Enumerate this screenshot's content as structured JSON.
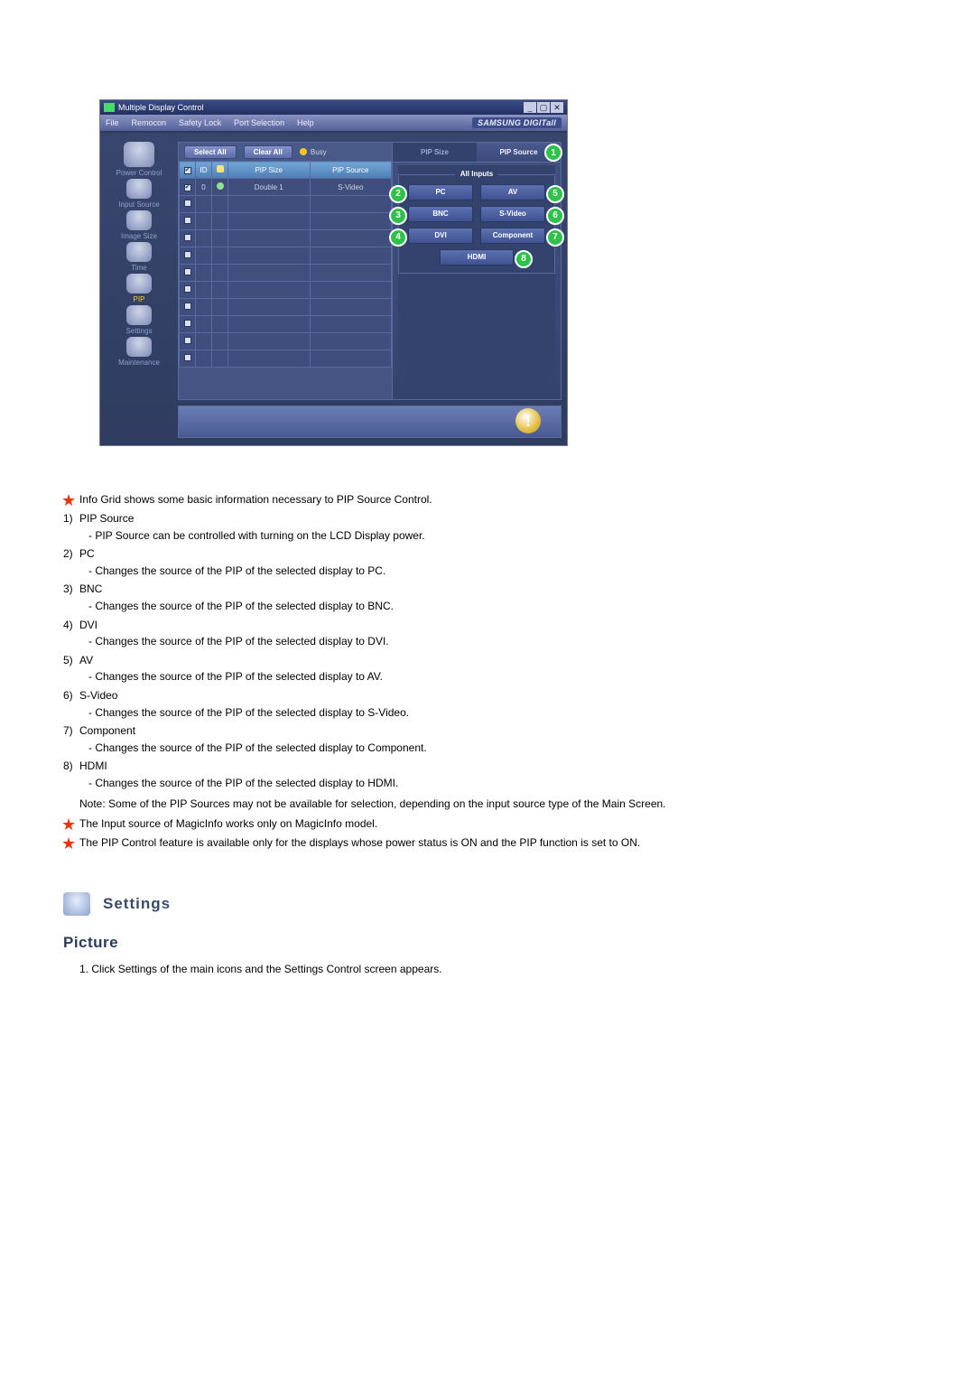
{
  "win": {
    "title": "Multiple Display Control",
    "menus": [
      "File",
      "Remocon",
      "Safety Lock",
      "Port Selection",
      "Help"
    ],
    "brand": "SAMSUNG DIGITall"
  },
  "sidebar": {
    "items": [
      {
        "label": "Power Control"
      },
      {
        "label": "Input Source"
      },
      {
        "label": "Image Size"
      },
      {
        "label": "Time"
      },
      {
        "label": "PIP"
      },
      {
        "label": "Settings"
      },
      {
        "label": "Maintenance"
      }
    ],
    "active_index": 4
  },
  "topbuttons": {
    "select_all": "Select All",
    "clear_all": "Clear All",
    "busy": "Busy"
  },
  "grid": {
    "headers": {
      "chk": "",
      "id": "ID",
      "status": "",
      "pip_size": "PIP Size",
      "pip_source": "PIP Source"
    },
    "rows": [
      {
        "chk": true,
        "id": "0",
        "status": "on",
        "pip_size": "Double 1",
        "pip_source": "S-Video"
      }
    ]
  },
  "right": {
    "tab_inactive": "PIP Size",
    "tab_active": "PIP Source",
    "legend": "All Inputs",
    "buttons": {
      "pc": "PC",
      "bnc": "BNC",
      "dvi": "DVI",
      "av": "AV",
      "svideo": "S-Video",
      "component": "Component",
      "hdmi": "HDMI"
    },
    "badges": {
      "tab": "1",
      "pc": "2",
      "bnc": "3",
      "dvi": "4",
      "av": "5",
      "svideo": "6",
      "component": "7",
      "hdmi": "8"
    }
  },
  "doc": {
    "intro": "Info Grid shows some basic information necessary to PIP Source Control.",
    "list": [
      {
        "n": "1)",
        "t": "PIP Source",
        "d": "- PIP Source can be controlled with turning on the LCD Display power."
      },
      {
        "n": "2)",
        "t": "PC",
        "d": "- Changes the source of the PIP of the selected display to PC."
      },
      {
        "n": "3)",
        "t": "BNC",
        "d": "- Changes the source of the PIP of the selected display to BNC."
      },
      {
        "n": "4)",
        "t": "DVI",
        "d": "- Changes the source of the PIP of the selected display to DVI."
      },
      {
        "n": "5)",
        "t": "AV",
        "d": "- Changes the source of the PIP of the selected display to AV."
      },
      {
        "n": "6)",
        "t": "S-Video",
        "d": "- Changes the source of the PIP of the selected display to S-Video."
      },
      {
        "n": "7)",
        "t": "Component",
        "d": "- Changes the source of the PIP of the selected display to Component."
      },
      {
        "n": "8)",
        "t": "HDMI",
        "d": "- Changes the source of the PIP of the selected display to HDMI."
      }
    ],
    "note": "Note: Some of the PIP Sources may not be available for selection, depending on the input source type of the Main Screen.",
    "foot1": "The Input source of MagicInfo works only on MagicInfo model.",
    "foot2": "The PIP Control feature is available only for the displays whose power status is ON and the PIP function is set to ON.",
    "section_title": "Settings",
    "sub_title": "Picture",
    "sub_step_n": "1.",
    "sub_step": "Click Settings of the main icons and the Settings Control screen appears."
  }
}
